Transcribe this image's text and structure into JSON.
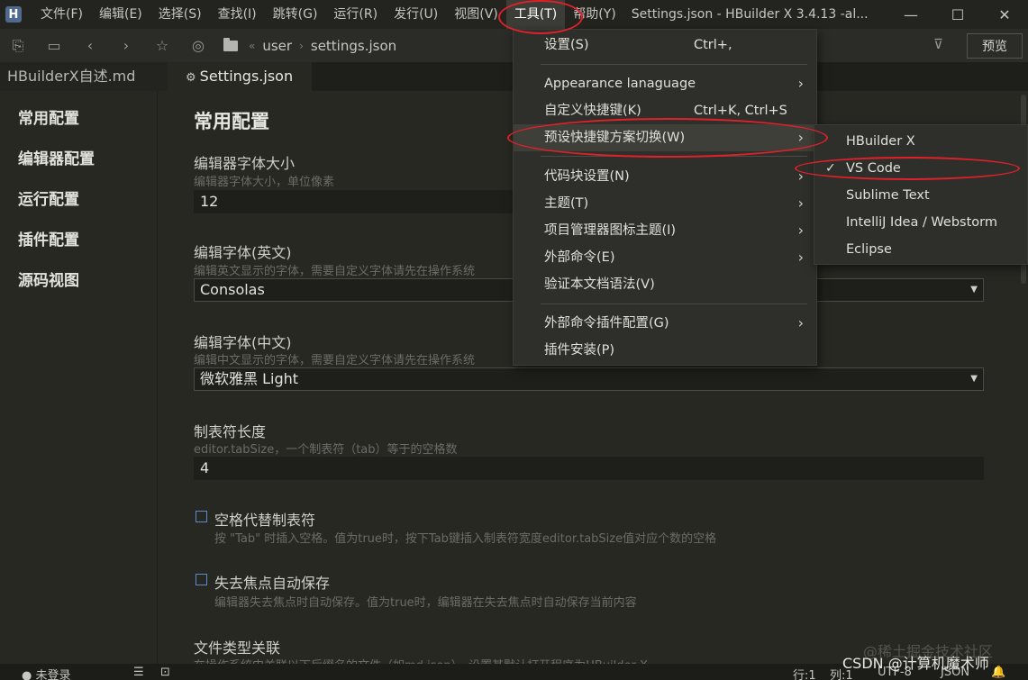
{
  "window": {
    "title": "Settings.json - HBuilder X 3.4.13 -al...",
    "menu": [
      "文件(F)",
      "编辑(E)",
      "选择(S)",
      "查找(I)",
      "跳转(G)",
      "运行(R)",
      "发行(U)",
      "视图(V)",
      "工具(T)",
      "帮助(Y)"
    ],
    "logo": "H"
  },
  "toolbar": {
    "breadcrumb_user": "user",
    "breadcrumb_file": "settings.json",
    "preview_label": "预览"
  },
  "tabs": [
    {
      "label": "HBuilderX自述.md"
    },
    {
      "label": "Settings.json"
    }
  ],
  "sidebar": {
    "items": [
      "常用配置",
      "编辑器配置",
      "运行配置",
      "插件配置",
      "源码视图"
    ]
  },
  "settings": {
    "section_title": "常用配置",
    "font_size": {
      "label": "编辑器字体大小",
      "desc": "编辑器字体大小，单位像素",
      "value": "12"
    },
    "font_en": {
      "label": "编辑字体(英文)",
      "desc": "编辑英文显示的字体，需要自定义字体请先在操作系统",
      "value": "Consolas"
    },
    "font_cn": {
      "label": "编辑字体(中文)",
      "desc": "编辑中文显示的字体，需要自定义字体请先在操作系统",
      "value": "微软雅黑 Light"
    },
    "tab_size": {
      "label": "制表符长度",
      "desc": "editor.tabSize，一个制表符（tab）等于的空格数",
      "value": "4"
    },
    "insert_spaces": {
      "label": "空格代替制表符",
      "desc": "按 \"Tab\" 时插入空格。值为true时，按下Tab键插入制表符宽度editor.tabSize值对应个数的空格"
    },
    "auto_save": {
      "label": "失去焦点自动保存",
      "desc": "编辑器失去焦点时自动保存。值为true时，编辑器在失去焦点时自动保存当前内容"
    },
    "file_assoc": {
      "label": "文件类型关联",
      "desc": "在操作系统中关联以下后缀名的文件（如md,json），设置其默认打开程序为HBuilder X"
    }
  },
  "status": {
    "login": "未登录",
    "position": "行:1",
    "column": "列:1",
    "encoding": "UTF-8",
    "language": "JSON"
  },
  "tools_menu": {
    "items": [
      {
        "label": "设置(S)",
        "shortcut": "Ctrl+,"
      },
      {
        "label": "Appearance lanaguage",
        "shortcut": ""
      },
      {
        "label": "自定义快捷键(K)",
        "shortcut": "Ctrl+K, Ctrl+S"
      },
      {
        "label": "预设快捷键方案切换(W)",
        "shortcut": ""
      },
      {
        "label": "代码块设置(N)",
        "shortcut": ""
      },
      {
        "label": "主题(T)",
        "shortcut": ""
      },
      {
        "label": "项目管理器图标主题(I)",
        "shortcut": ""
      },
      {
        "label": "外部命令(E)",
        "shortcut": ""
      },
      {
        "label": "验证本文档语法(V)",
        "shortcut": ""
      },
      {
        "label": "外部命令插件配置(G)",
        "shortcut": ""
      },
      {
        "label": "插件安装(P)",
        "shortcut": ""
      }
    ]
  },
  "keymap_submenu": {
    "items": [
      "HBuilder X",
      "VS Code",
      "Sublime Text",
      "IntelliJ Idea / Webstorm",
      "Eclipse"
    ],
    "checked": "VS Code"
  },
  "watermark": {
    "line1": "@稀土掘金技术社区",
    "line2": "CSDN @计算机魔术师"
  },
  "colors": {
    "background": "#272822",
    "menu_background": "#2e2f2a",
    "annotation": "#e0202a",
    "checkbox": "#5a8ad6"
  }
}
